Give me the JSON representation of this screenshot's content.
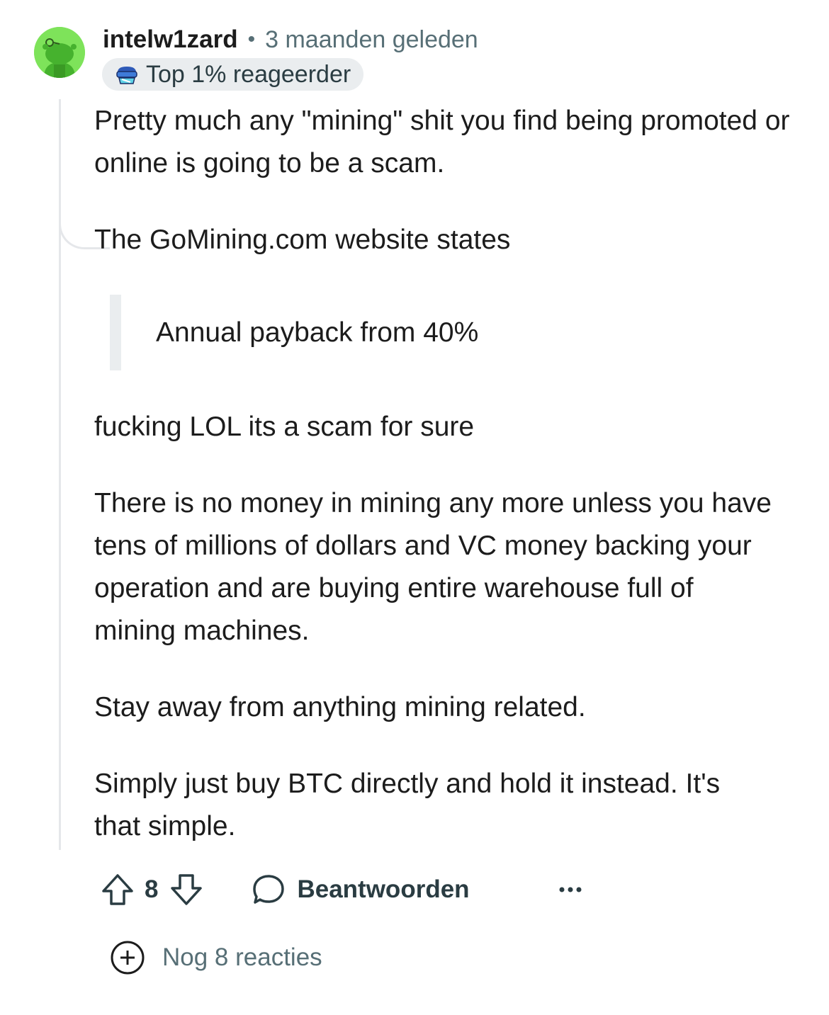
{
  "comment": {
    "author": "intelw1zard",
    "separator": "•",
    "time_ago": "3 maanden geleden",
    "flair": "Top 1% reageerder",
    "paragraphs": [
      "Pretty much any \"mining\" shit you find being promoted or online is going to be a scam.",
      "The GoMining.com website states",
      "fucking LOL its a scam for sure",
      "There is no money in mining any more unless you have tens of millions of dollars and VC money backing your operation and are buying entire warehouse full of mining machines.",
      "Stay away from anything mining related.",
      "Simply just buy BTC directly and hold it instead. It's that simple."
    ],
    "quote": "Annual payback from 40%"
  },
  "actions": {
    "vote_count": "8",
    "reply_label": "Beantwoorden",
    "upvote_icon": "upvote-arrow-icon",
    "downvote_icon": "downvote-arrow-icon",
    "reply_icon": "speech-bubble-icon",
    "more_icon": "ellipsis-icon"
  },
  "more_replies": {
    "label": "Nog 8 reacties",
    "icon": "plus-circle-icon"
  },
  "colors": {
    "avatar_bg": "#7ee35a",
    "text": "#1c1c1c",
    "meta": "#576f76",
    "flair_bg": "#eaedef",
    "thread_line": "#e5e7ea"
  }
}
